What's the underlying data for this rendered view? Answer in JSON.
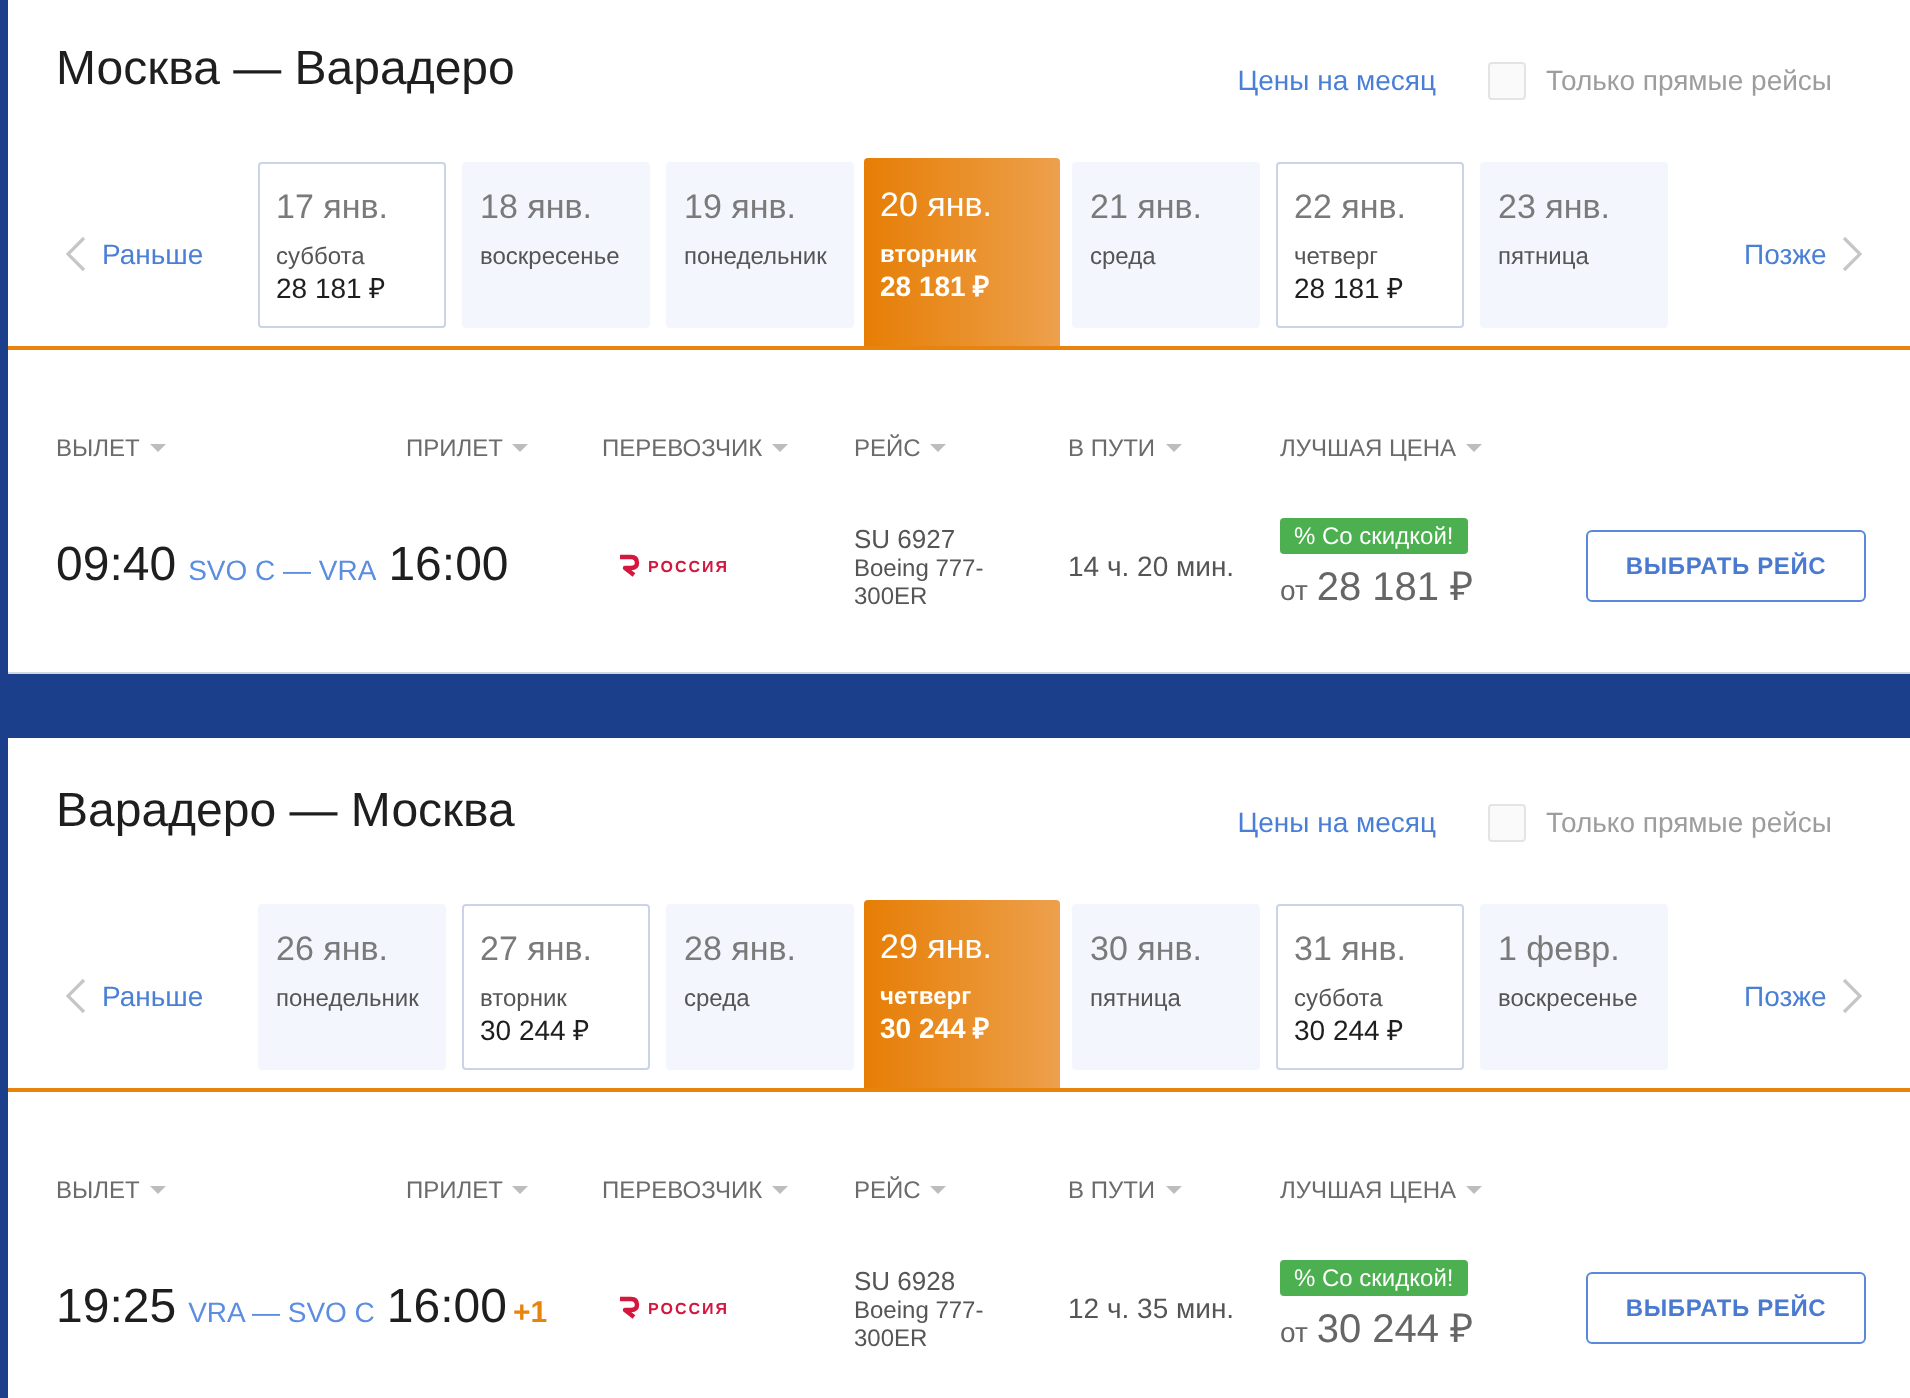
{
  "trips": [
    {
      "title": "Москва — Варадеро",
      "month_prices_link": "Цены на месяц",
      "direct_only": {
        "label": "Только прямые рейсы",
        "checked": false
      },
      "dates": {
        "earlier": "Раньше",
        "later": "Позже",
        "days": [
          {
            "date": "17 янв.",
            "weekday": "суббота",
            "price": "28 181 ₽",
            "selected": false
          },
          {
            "date": "18 янв.",
            "weekday": "воскресенье",
            "selected": false
          },
          {
            "date": "19 янв.",
            "weekday": "понедельник",
            "selected": false
          },
          {
            "date": "20 янв.",
            "weekday": "вторник",
            "price": "28 181 ₽",
            "selected": true
          },
          {
            "date": "21 янв.",
            "weekday": "среда",
            "selected": false
          },
          {
            "date": "22 янв.",
            "weekday": "четверг",
            "price": "28 181 ₽",
            "selected": false
          },
          {
            "date": "23 янв.",
            "weekday": "пятница",
            "selected": false
          }
        ]
      },
      "columns": [
        "ВЫЛЕТ",
        "ПРИЛЕТ",
        "ПЕРЕВОЗЧИК",
        "РЕЙС",
        "В ПУТИ",
        "ЛУЧШАЯ ЦЕНА"
      ],
      "flights": [
        {
          "departure_time": "09:40",
          "route": "SVO C — VRA",
          "arrival_time": "16:00",
          "carrier_logo_text": "РОССИЯ",
          "flight_number": "SU 6927",
          "aircraft": "Boeing 777-300ER",
          "duration": "14 ч. 20 мин.",
          "badge": "% Со скидкой!",
          "price_prefix": "от",
          "price": "28 181 ₽",
          "button": "ВЫБРАТЬ РЕЙС"
        }
      ]
    },
    {
      "title": "Варадеро — Москва",
      "month_prices_link": "Цены на месяц",
      "direct_only": {
        "label": "Только прямые рейсы",
        "checked": false
      },
      "dates": {
        "earlier": "Раньше",
        "later": "Позже",
        "days": [
          {
            "date": "26 янв.",
            "weekday": "понедельник",
            "selected": false
          },
          {
            "date": "27 янв.",
            "weekday": "вторник",
            "price": "30 244 ₽",
            "selected": false
          },
          {
            "date": "28 янв.",
            "weekday": "среда",
            "selected": false
          },
          {
            "date": "29 янв.",
            "weekday": "четверг",
            "price": "30 244 ₽",
            "selected": true
          },
          {
            "date": "30 янв.",
            "weekday": "пятница",
            "selected": false
          },
          {
            "date": "31 янв.",
            "weekday": "суббота",
            "price": "30 244 ₽",
            "selected": false
          },
          {
            "date": "1 февр.",
            "weekday": "воскресенье",
            "selected": false
          }
        ]
      },
      "columns": [
        "ВЫЛЕТ",
        "ПРИЛЕТ",
        "ПЕРЕВОЗЧИК",
        "РЕЙС",
        "В ПУТИ",
        "ЛУЧШАЯ ЦЕНА"
      ],
      "flights": [
        {
          "departure_time": "19:25",
          "route": "VRA — SVO C",
          "arrival_time": "16:00",
          "next_day": "+1",
          "carrier_logo_text": "РОССИЯ",
          "flight_number": "SU 6928",
          "aircraft": "Boeing 777-300ER",
          "duration": "12 ч. 35 мин.",
          "badge": "% Со скидкой!",
          "price_prefix": "от",
          "price": "30 244 ₽",
          "button": "ВЫБРАТЬ РЕЙС"
        }
      ]
    }
  ]
}
